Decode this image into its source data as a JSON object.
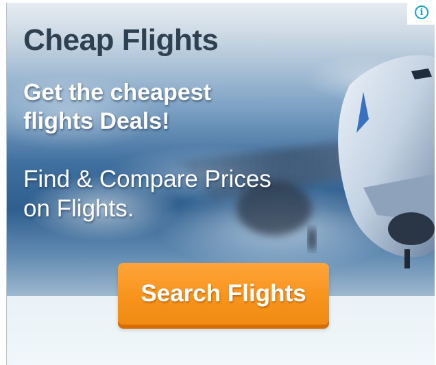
{
  "ad": {
    "headline": "Cheap Flights",
    "tagline_line1": "Get the cheapest",
    "tagline_line2": "flights Deals!",
    "subtext_line1": "Find & Compare Prices",
    "subtext_line2": "on Flights.",
    "cta_label": "Search Flights",
    "info_icon": "info-icon",
    "info_symbol": "i"
  },
  "colors": {
    "cta": "#f7941d",
    "headline": "#2f4050",
    "info": "#14a4cc"
  }
}
